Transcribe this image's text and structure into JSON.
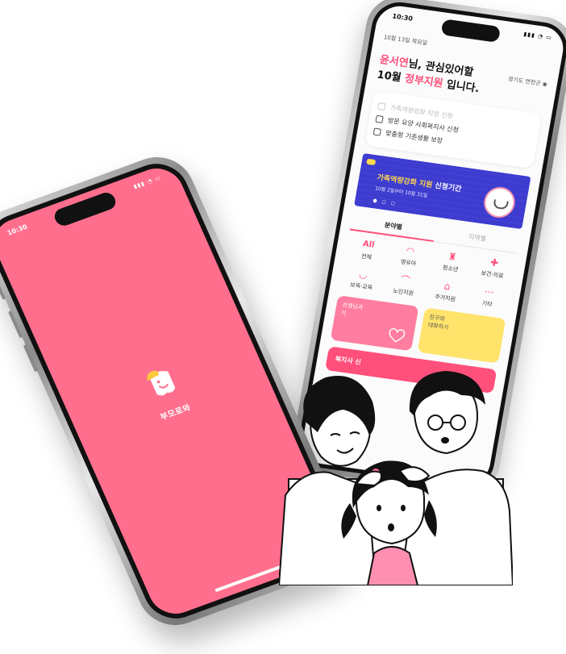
{
  "back_phone": {
    "status_time": "10:30",
    "date": "10월 13일 목요일",
    "region": "경기도 연천군",
    "greeting_name": "윤서연",
    "greeting_rest_line1": "님, 관심있어할",
    "greeting_month": "10월 ",
    "greeting_highlight": "정부지원",
    "greeting_end": " 입니다.",
    "checklist": [
      {
        "label": "가족역량강화 지원 신청",
        "faded": true
      },
      {
        "label": "방문 요양 사회복지사 신청",
        "faded": false
      },
      {
        "label": "맞춤형 기존생활 보장",
        "faded": false
      }
    ],
    "banner": {
      "title_highlight": "가족역량강화 지원",
      "title_rest": " 신청기간",
      "subtitle": "10월 2일부터 10월 31일"
    },
    "tabs": [
      {
        "label": "분야별",
        "active": true
      },
      {
        "label": "지역별",
        "active": false
      }
    ],
    "categories": [
      {
        "icon": "all-text",
        "label": "전체",
        "top": "All"
      },
      {
        "icon": "baby-icon",
        "label": "영유아",
        "top": "◠"
      },
      {
        "icon": "youth-icon",
        "label": "청소년",
        "top": "♜"
      },
      {
        "icon": "medical-icon",
        "label": "보건·의료",
        "top": "✚"
      },
      {
        "icon": "education-icon",
        "label": "보육·교육",
        "top": "◡"
      },
      {
        "icon": "cane-icon",
        "label": "노인지원",
        "top": "⌒"
      },
      {
        "icon": "house-icon",
        "label": "주거지원",
        "top": "⌂"
      },
      {
        "icon": "more-icon",
        "label": "기타",
        "top": "···"
      }
    ],
    "promo": {
      "pink_text": "선생님과\n기",
      "yellow_text": "친구와\n대화하기",
      "wide_text": "복지사 신"
    }
  },
  "front_phone": {
    "status_time": "10:30",
    "app_name": "부모로와",
    "background_color": "#ff6f8d"
  }
}
